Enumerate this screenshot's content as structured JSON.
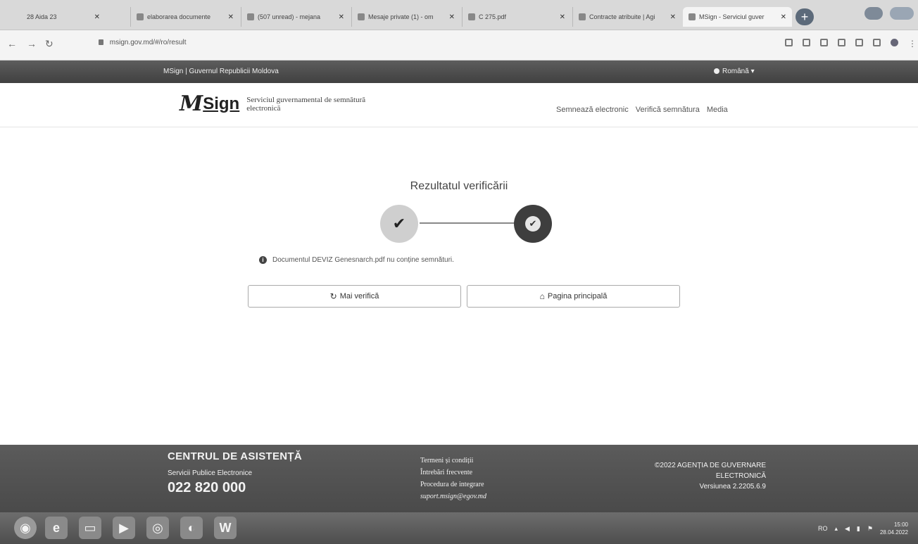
{
  "browser": {
    "tabs": [
      {
        "label": "28 Aida 23"
      },
      {
        "label": "elaborarea documente"
      },
      {
        "label": "(507 unread) - mejana"
      },
      {
        "label": "Mesaje private (1) - om"
      },
      {
        "label": "C 275.pdf"
      },
      {
        "label": "Contracte atribuite | Agi"
      },
      {
        "label": "MSign - Serviciul guver"
      }
    ],
    "url": "msign.gov.md/#/ro/result"
  },
  "govbar": {
    "brand": "MSign | Guvernul Republicii Moldova",
    "language": "Română"
  },
  "header": {
    "logo_mark": "M",
    "logo_sign": "Sign",
    "tagline": "Serviciul guvernamental de semnătură electronică",
    "nav": [
      "Semnează electronic",
      "Verifică semnătura",
      "Media"
    ]
  },
  "result": {
    "title": "Rezultatul verificării",
    "message": "Documentul DEVIZ Genesnarch.pdf nu conține semnături.",
    "buttons": {
      "check_again": "Mai verifică",
      "home": "Pagina principală"
    }
  },
  "footer": {
    "support_title": "CENTRUL DE ASISTENȚĂ",
    "support_sub": "Servicii Publice Electronice",
    "phone": "022 820 000",
    "links": [
      "Termeni și condiții",
      "Întrebări frecvente",
      "Procedura de integrare"
    ],
    "email": "suport.msign@egov.md",
    "copyright": "©2022 AGENȚIA DE GUVERNARE ELECTRONICĂ",
    "version": "Versiunea 2.2205.6.9"
  },
  "taskbar": {
    "lang": "RO",
    "time": "15:00",
    "date": "28.04.2022"
  }
}
